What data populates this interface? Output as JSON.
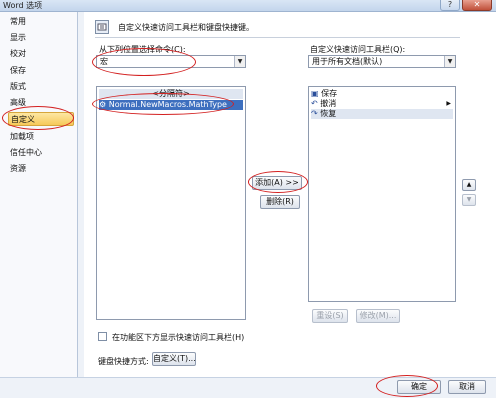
{
  "window": {
    "title": "Word 选项",
    "help_symbol": "?",
    "close_symbol": "✕"
  },
  "nav": {
    "items": [
      "常用",
      "显示",
      "校对",
      "保存",
      "版式",
      "高级",
      "自定义",
      "加载项",
      "信任中心",
      "资源"
    ],
    "selected_index": 6
  },
  "header": {
    "text": "自定义快速访问工具栏和键盘快捷键。"
  },
  "left_panel": {
    "choose_label": "从下列位置选择命令(C):",
    "choose_value": "宏",
    "separator_item": "<分隔符>",
    "macro_item": "Normal.NewMacros.MathType"
  },
  "right_panel": {
    "customize_label": "自定义快速访问工具栏(Q):",
    "customize_value": "用于所有文档(默认)",
    "items": [
      "保存",
      "撤消",
      "恢复"
    ]
  },
  "buttons": {
    "add": "添加(A) >>",
    "remove": "删除(R)",
    "reset": "重设(S)",
    "modify": "修改(M)...",
    "customize_shortcut": "自定义(T)...",
    "ok": "确定",
    "cancel": "取消"
  },
  "options": {
    "show_below_ribbon": "在功能区下方显示快速访问工具栏(H)",
    "keyboard_shortcuts_label": "键盘快捷方式:"
  },
  "icons": {
    "help": "help-icon",
    "close": "close-icon",
    "header": "toolbar-icon",
    "dropdown": "chevron-down-icon",
    "macro": "macro-icon",
    "save": "save-icon",
    "undo": "undo-icon",
    "redo": "redo-icon",
    "move_up": "arrow-up-icon",
    "move_down": "arrow-down-icon"
  },
  "colors": {
    "annotation": "#d32020",
    "selection": "#3d6fbf",
    "nav_selected": "#f6c95a"
  }
}
